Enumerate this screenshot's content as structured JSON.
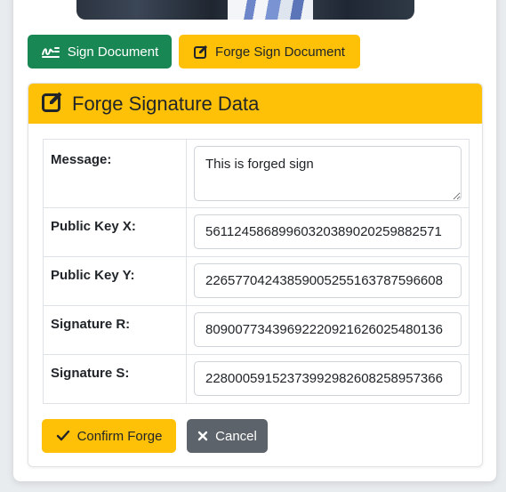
{
  "actions": {
    "sign_label": "Sign Document",
    "forge_label": "Forge Sign Document"
  },
  "panel": {
    "title": "Forge Signature Data",
    "fields": [
      {
        "label": "Message:",
        "value": "This is forged sign"
      },
      {
        "label": "Public Key X:",
        "value": "56112458689960320389020259882571"
      },
      {
        "label": "Public Key Y:",
        "value": "22657704243859005255163787596608"
      },
      {
        "label": "Signature R:",
        "value": "80900773439692220921626025480136"
      },
      {
        "label": "Signature S:",
        "value": "22800059152373992982608258957366"
      }
    ],
    "confirm_label": "Confirm Forge",
    "cancel_label": "Cancel"
  },
  "colors": {
    "success": "#198754",
    "warning": "#ffc107",
    "secondary": "#5c636a"
  },
  "icons": {
    "sign": "signature-icon",
    "forge": "edit-icon",
    "confirm": "check-icon",
    "cancel": "close-icon"
  }
}
